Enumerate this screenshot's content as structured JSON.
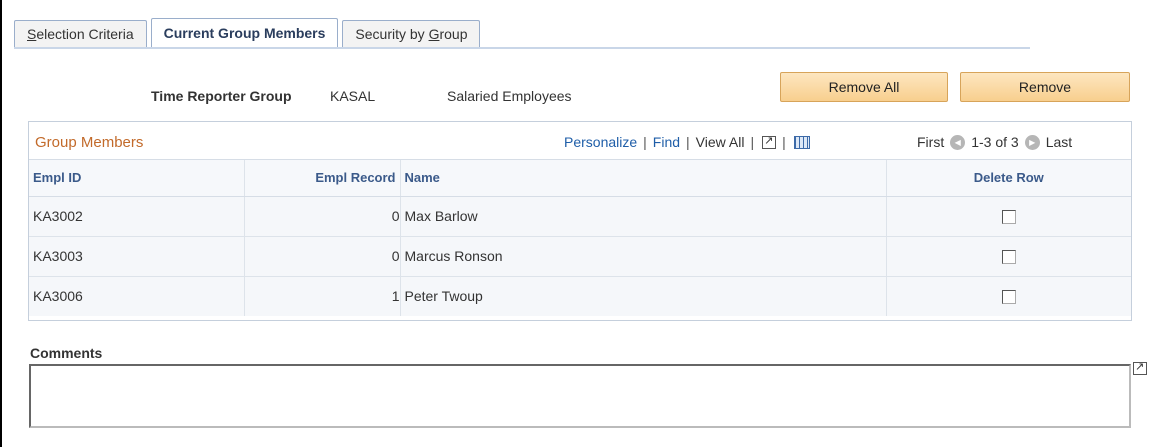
{
  "tabs": [
    {
      "label_prefix": "",
      "label_underline": "S",
      "label_suffix": "election Criteria"
    },
    {
      "label": "Current Group Members"
    },
    {
      "label_prefix": "Security by ",
      "label_underline": "G",
      "label_suffix": "roup"
    }
  ],
  "header": {
    "group_label": "Time Reporter Group",
    "group_code": "KASAL",
    "group_description": "Salaried Employees"
  },
  "buttons": {
    "remove_all": "Remove All",
    "remove": "Remove"
  },
  "grid": {
    "title": "Group Members",
    "tools": {
      "personalize": "Personalize",
      "find": "Find",
      "view_all": "View All"
    },
    "nav": {
      "first": "First",
      "range": "1-3 of 3",
      "last": "Last"
    },
    "columns": {
      "empl_id": "Empl ID",
      "empl_record": "Empl Record",
      "name": "Name",
      "delete_row": "Delete Row"
    },
    "rows": [
      {
        "empl_id": "KA3002",
        "empl_record": "0",
        "name": "Max Barlow",
        "delete": false
      },
      {
        "empl_id": "KA3003",
        "empl_record": "0",
        "name": "Marcus Ronson",
        "delete": false
      },
      {
        "empl_id": "KA3006",
        "empl_record": "1",
        "name": "Peter Twoup",
        "delete": false
      }
    ]
  },
  "comments": {
    "label": "Comments",
    "value": ""
  },
  "colors": {
    "button_fill": "#f8cf8e",
    "grid_title": "#c26a2a",
    "link": "#1f5ea8",
    "column_header": "#3b5a8a"
  }
}
